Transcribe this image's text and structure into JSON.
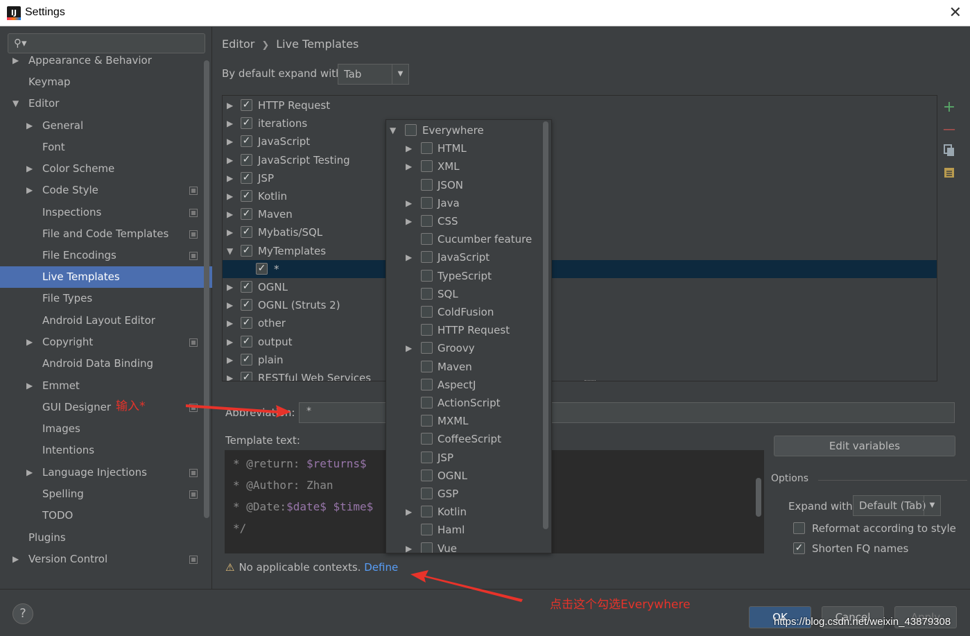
{
  "window": {
    "title": "Settings",
    "app_icon": "IJ",
    "close_glyph": "✕"
  },
  "sidebar": {
    "items": [
      {
        "label": "Appearance & Behavior",
        "arrow": "▶"
      },
      {
        "label": "Keymap",
        "arrow": ""
      },
      {
        "label": "Editor",
        "arrow": "▼"
      },
      {
        "label": "General",
        "arrow": "▶"
      },
      {
        "label": "Font",
        "arrow": ""
      },
      {
        "label": "Color Scheme",
        "arrow": "▶"
      },
      {
        "label": "Code Style",
        "arrow": "▶"
      },
      {
        "label": "Inspections",
        "arrow": ""
      },
      {
        "label": "File and Code Templates",
        "arrow": ""
      },
      {
        "label": "File Encodings",
        "arrow": ""
      },
      {
        "label": "Live Templates",
        "arrow": ""
      },
      {
        "label": "File Types",
        "arrow": ""
      },
      {
        "label": "Android Layout Editor",
        "arrow": ""
      },
      {
        "label": "Copyright",
        "arrow": "▶"
      },
      {
        "label": "Android Data Binding",
        "arrow": ""
      },
      {
        "label": "Emmet",
        "arrow": "▶"
      },
      {
        "label": "GUI Designer",
        "arrow": ""
      },
      {
        "label": "Images",
        "arrow": ""
      },
      {
        "label": "Intentions",
        "arrow": ""
      },
      {
        "label": "Language Injections",
        "arrow": "▶"
      },
      {
        "label": "Spelling",
        "arrow": ""
      },
      {
        "label": "TODO",
        "arrow": ""
      },
      {
        "label": "Plugins",
        "arrow": ""
      },
      {
        "label": "Version Control",
        "arrow": "▶"
      }
    ]
  },
  "breadcrumb": {
    "parent": "Editor",
    "sep": "❯",
    "current": "Live Templates"
  },
  "expand_default": {
    "label": "By default expand with",
    "value": "Tab"
  },
  "template_groups": [
    {
      "label": "HTTP Request",
      "arrow": "▶",
      "checked": "✓"
    },
    {
      "label": "iterations",
      "arrow": "▶",
      "checked": "✓"
    },
    {
      "label": "JavaScript",
      "arrow": "▶",
      "checked": "✓"
    },
    {
      "label": "JavaScript Testing",
      "arrow": "▶",
      "checked": "✓"
    },
    {
      "label": "JSP",
      "arrow": "▶",
      "checked": "✓"
    },
    {
      "label": "Kotlin",
      "arrow": "▶",
      "checked": "✓"
    },
    {
      "label": "Maven",
      "arrow": "▶",
      "checked": "✓"
    },
    {
      "label": "Mybatis/SQL",
      "arrow": "▶",
      "checked": "✓"
    },
    {
      "label": "MyTemplates",
      "arrow": "▼",
      "checked": "✓"
    },
    {
      "label": "*",
      "arrow": "",
      "checked": "✓"
    },
    {
      "label": "OGNL",
      "arrow": "▶",
      "checked": "✓"
    },
    {
      "label": "OGNL (Struts 2)",
      "arrow": "▶",
      "checked": "✓"
    },
    {
      "label": "other",
      "arrow": "▶",
      "checked": "✓"
    },
    {
      "label": "output",
      "arrow": "▶",
      "checked": "✓"
    },
    {
      "label": "plain",
      "arrow": "▶",
      "checked": "✓"
    },
    {
      "label": "RESTful Web Services",
      "arrow": "▶",
      "checked": "✓"
    }
  ],
  "toolbar": {
    "add": "+",
    "remove": "—"
  },
  "abbreviation": {
    "label": "Abbreviation:",
    "value": "*"
  },
  "template_text": {
    "label": "Template text:",
    "lines": [
      {
        "pre": "* @return: ",
        "var": "$returns$",
        "post": ""
      },
      {
        "pre": "* @Author: Zhan",
        "var": "",
        "post": ""
      },
      {
        "pre": "* @Date:",
        "var": "$date$ $time$",
        "post": ""
      },
      {
        "pre": "*/",
        "var": "",
        "post": ""
      }
    ]
  },
  "edit_variables": "Edit variables",
  "options": {
    "title": "Options",
    "expand_with_label": "Expand with",
    "expand_with_value": "Default (Tab)",
    "reformat": {
      "label": "Reformat according to style",
      "checked": ""
    },
    "shorten": {
      "label": "Shorten FQ names",
      "checked": "✓"
    }
  },
  "warning": {
    "icon": "⚠",
    "text": "No applicable contexts.",
    "link": "Define"
  },
  "contexts": [
    {
      "label": "Everywhere",
      "arrow": "▼"
    },
    {
      "label": "HTML",
      "arrow": "▶"
    },
    {
      "label": "XML",
      "arrow": "▶"
    },
    {
      "label": "JSON",
      "arrow": ""
    },
    {
      "label": "Java",
      "arrow": "▶"
    },
    {
      "label": "CSS",
      "arrow": "▶"
    },
    {
      "label": "Cucumber feature",
      "arrow": ""
    },
    {
      "label": "JavaScript",
      "arrow": "▶"
    },
    {
      "label": "TypeScript",
      "arrow": ""
    },
    {
      "label": "SQL",
      "arrow": ""
    },
    {
      "label": "ColdFusion",
      "arrow": ""
    },
    {
      "label": "HTTP Request",
      "arrow": ""
    },
    {
      "label": "Groovy",
      "arrow": "▶"
    },
    {
      "label": "Maven",
      "arrow": ""
    },
    {
      "label": "AspectJ",
      "arrow": ""
    },
    {
      "label": "ActionScript",
      "arrow": ""
    },
    {
      "label": "MXML",
      "arrow": ""
    },
    {
      "label": "CoffeeScript",
      "arrow": ""
    },
    {
      "label": "JSP",
      "arrow": ""
    },
    {
      "label": "OGNL",
      "arrow": ""
    },
    {
      "label": "GSP",
      "arrow": ""
    },
    {
      "label": "Kotlin",
      "arrow": "▶"
    },
    {
      "label": "Haml",
      "arrow": ""
    },
    {
      "label": "Vue",
      "arrow": "▶"
    }
  ],
  "buttons": {
    "ok": "OK",
    "cancel": "Cancel",
    "apply": "Apply",
    "help": "?"
  },
  "annotations": {
    "input_note": "输入*",
    "click_note": "点击这个勾选Everywhere",
    "color": "#e8332a"
  },
  "watermark": "https://blog.csdn.net/weixin_43879308"
}
